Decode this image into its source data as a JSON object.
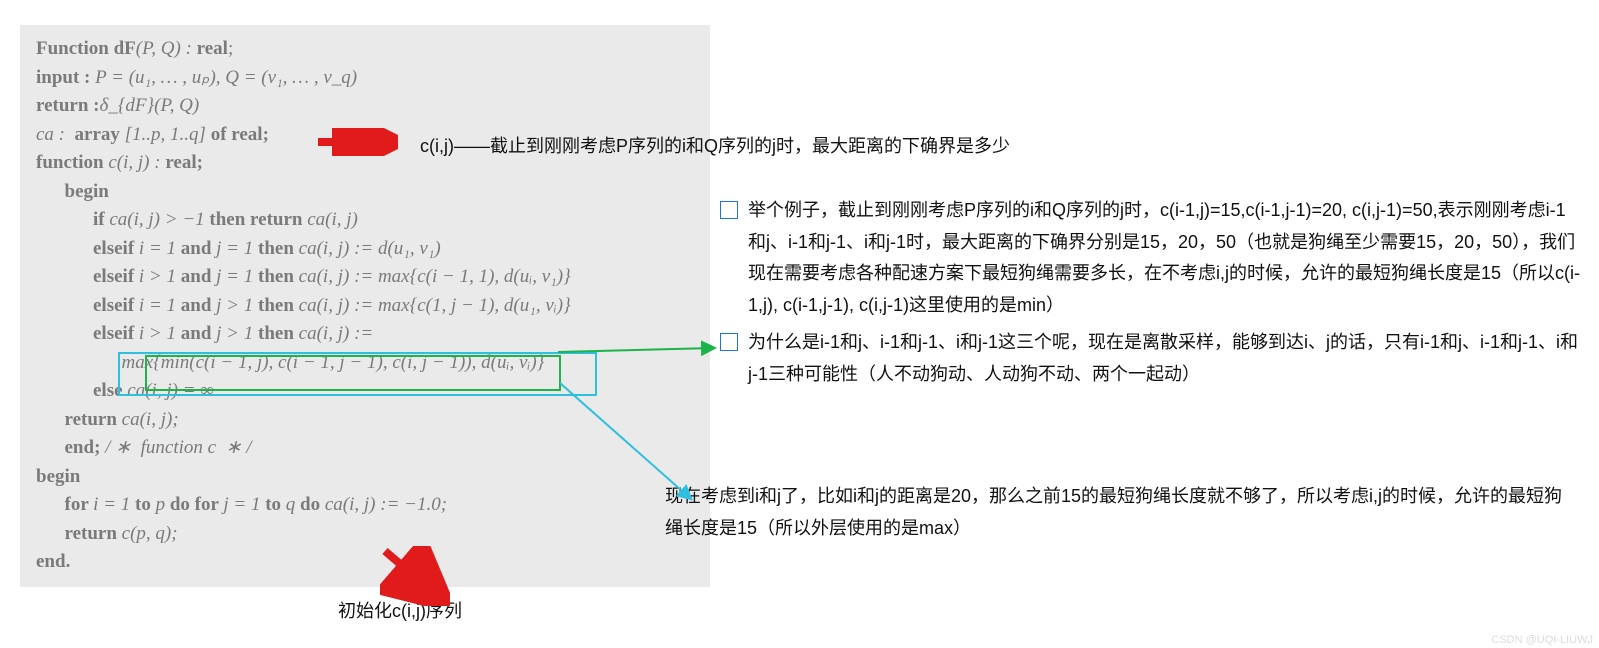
{
  "pseudocode": {
    "l1a": "Function dF",
    "l1b": "(P, Q) : ",
    "l1c": "real",
    "l1d": ";",
    "l2a": "input : ",
    "l2b": "P = (u₁, … , uₚ), Q = (v₁, … , v_q)",
    "l3a": "return :",
    "l3b": "δ_{dF}(P, Q)",
    "l4a": "ca :  ",
    "l4b": "array ",
    "l4c": "[1..p, 1..q] ",
    "l4d": "of real;",
    "l5a": "function ",
    "l5b": "c(i, j) : ",
    "l5c": "real;",
    "l6": "      begin",
    "l7a": "            if ",
    "l7b": "ca(i, j) > −1 ",
    "l7c": "then return ",
    "l7d": "ca(i, j)",
    "l8a": "            elseif ",
    "l8b": "i = 1 ",
    "l8c": "and ",
    "l8d": "j = 1 ",
    "l8e": "then ",
    "l8f": "ca(i, j) := d(u₁, v₁)",
    "l9a": "            elseif ",
    "l9b": "i > 1 ",
    "l9c": "and ",
    "l9d": "j = 1 ",
    "l9e": "then ",
    "l9f": "ca(i, j) := max{c(i − 1, 1), d(uᵢ, v₁)}",
    "l10a": "            elseif ",
    "l10b": "i = 1 ",
    "l10c": "and ",
    "l10d": "j > 1 ",
    "l10e": "then ",
    "l10f": "ca(i, j) := max{c(1, j − 1), d(u₁, vᵢ)}",
    "l11a": "            elseif ",
    "l11b": "i > 1 ",
    "l11c": "and ",
    "l11d": "j > 1 ",
    "l11e": "then ",
    "l11f": "ca(i, j) :=",
    "l12": "                  max{min(c(i − 1, j), c(i − 1, j − 1), c(i, j − 1)), d(uᵢ, vᵢ)}",
    "l13a": "            else ",
    "l13b": "ca(i, j) = ∞",
    "l14a": "      return ",
    "l14b": "ca(i, j);",
    "l15a": "      end; ",
    "l15b": "/ ∗  function c  ∗ /",
    "l16": "begin",
    "l17a": "      for ",
    "l17b": "i = 1 ",
    "l17c": "to ",
    "l17d": "p ",
    "l17e": "do for ",
    "l17f": "j = 1 ",
    "l17g": "to ",
    "l17h": "q ",
    "l17i": "do ",
    "l17j": "ca(i, j) := −1.0;",
    "l18a": "      return ",
    "l18b": "c(p, q);",
    "l19": "end."
  },
  "annotations": {
    "top": "c(i,j)——截止到刚刚考虑P序列的i和Q序列的j时，最大距离的下确界是多少",
    "init": "初始化c(i,j)序列",
    "note1": "举个例子，截止到刚刚考虑P序列的i和Q序列的j时，c(i-1,j)=15,c(i-1,j-1)=20, c(i,j-1)=50,表示刚刚考虑i-1和j、i-1和j-1、i和j-1时，最大距离的下确界分别是15，20，50（也就是狗绳至少需要15，20，50），我们现在需要考虑各种配速方案下最短狗绳需要多长，在不考虑i,j的时候，允许的最短狗绳长度是15（所以c(i-1,j), c(i-1,j-1), c(i,j-1)这里使用的是min）",
    "note2": "为什么是i-1和j、i-1和j-1、i和j-1这三个呢，现在是离散采样，能够到达i、j的话，只有i-1和j、i-1和j-1、i和j-1三种可能性（人不动狗动、人动狗不动、两个一起动）",
    "bottom": "现在考虑到i和j了，比如i和j的距离是20，那么之前15的最短狗绳长度就不够了，所以考虑i,j的时候，允许的最短狗绳长度是15（所以外层使用的是max）"
  },
  "watermark": "CSDN @UQI-LIUWJ"
}
